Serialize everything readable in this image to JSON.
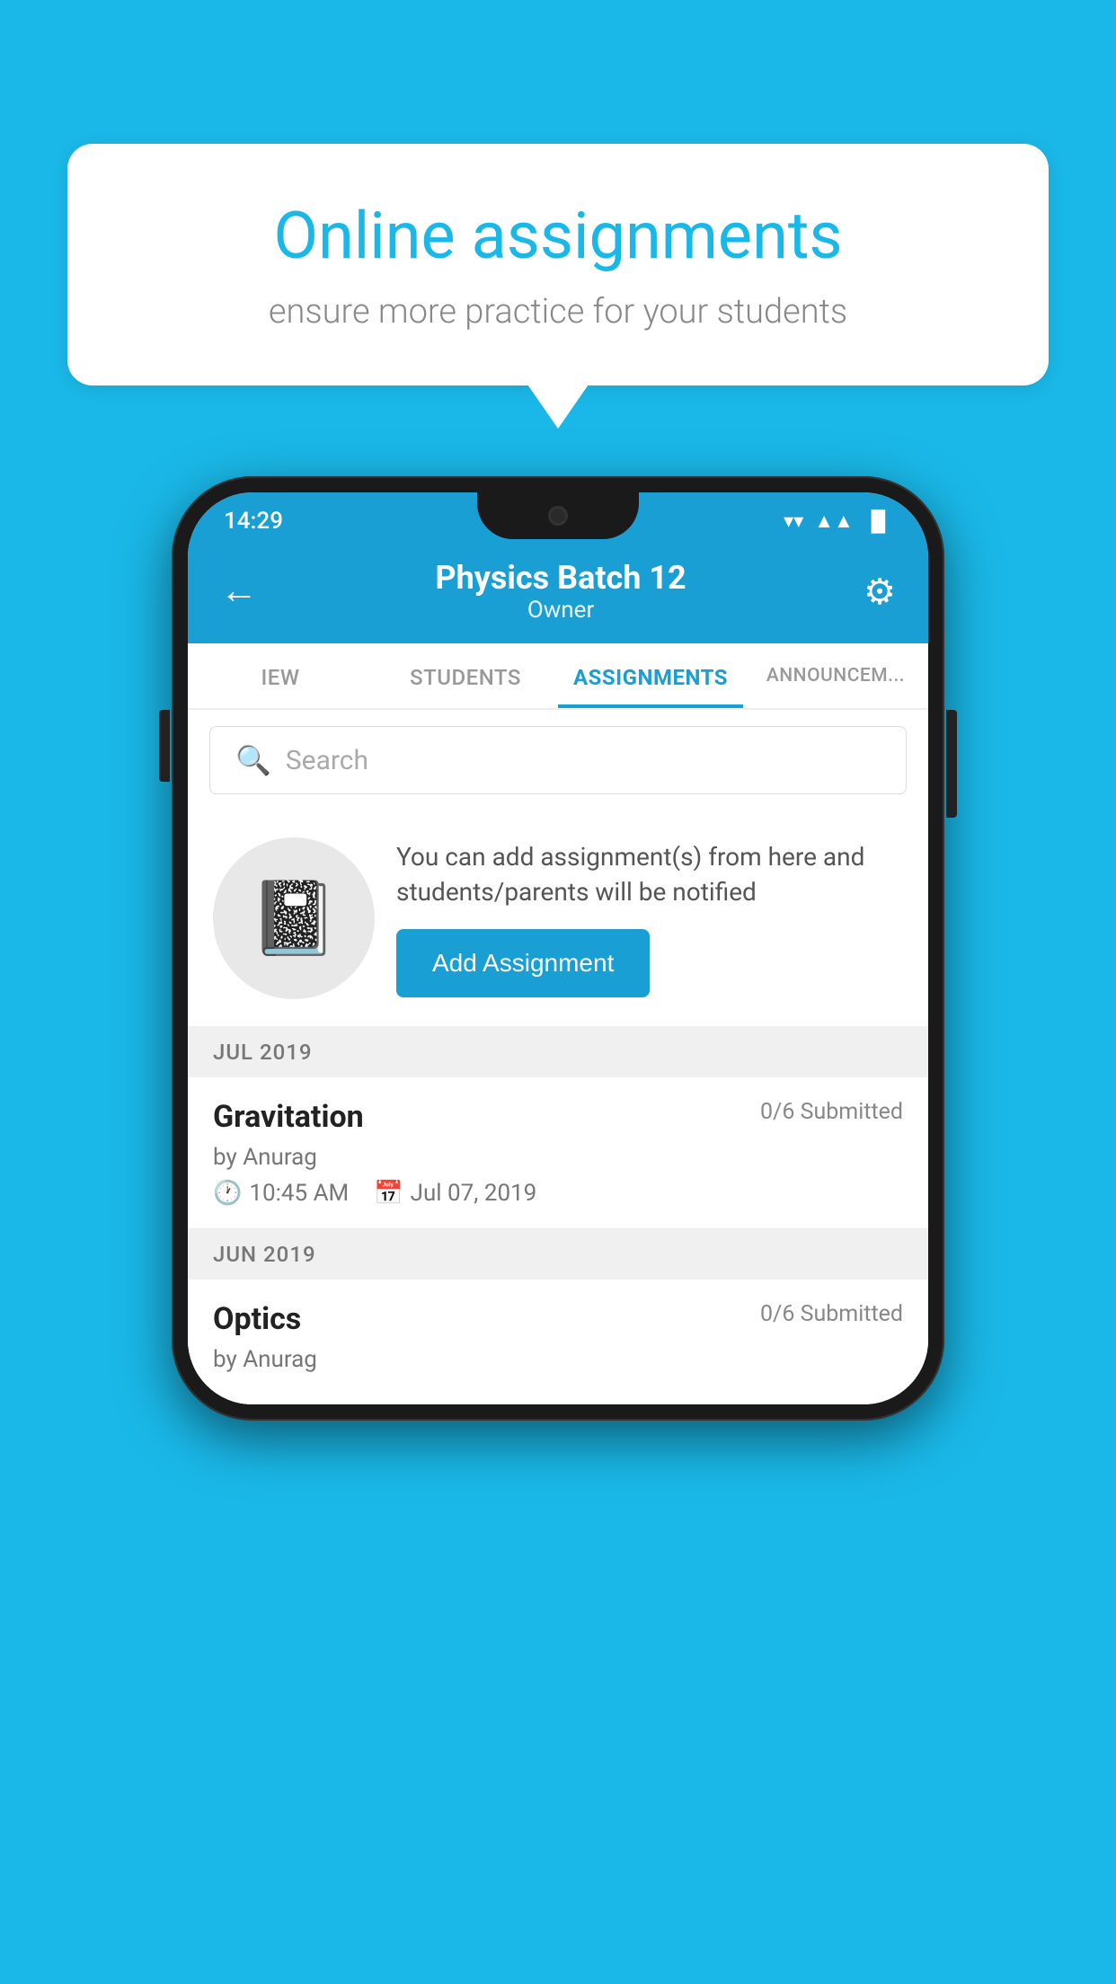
{
  "background": {
    "color": "#1ab8e8"
  },
  "speech_bubble": {
    "title": "Online assignments",
    "subtitle": "ensure more practice for your students"
  },
  "status_bar": {
    "time": "14:29",
    "wifi_icon": "▼",
    "signal_icon": "▲",
    "battery_icon": "▐"
  },
  "header": {
    "title": "Physics Batch 12",
    "subtitle": "Owner",
    "back_label": "←",
    "settings_label": "⚙"
  },
  "tabs": [
    {
      "label": "IEW",
      "active": false
    },
    {
      "label": "STUDENTS",
      "active": false
    },
    {
      "label": "ASSIGNMENTS",
      "active": true
    },
    {
      "label": "ANNOUNCEM...",
      "active": false
    }
  ],
  "search": {
    "placeholder": "Search"
  },
  "promo": {
    "description": "You can add assignment(s) from here and students/parents will be notified",
    "button_label": "Add Assignment"
  },
  "months": [
    {
      "label": "JUL 2019",
      "assignments": [
        {
          "title": "Gravitation",
          "submitted": "0/6 Submitted",
          "by": "by Anurag",
          "time": "10:45 AM",
          "date": "Jul 07, 2019"
        }
      ]
    },
    {
      "label": "JUN 2019",
      "assignments": [
        {
          "title": "Optics",
          "submitted": "0/6 Submitted",
          "by": "by Anurag",
          "time": "",
          "date": ""
        }
      ]
    }
  ]
}
